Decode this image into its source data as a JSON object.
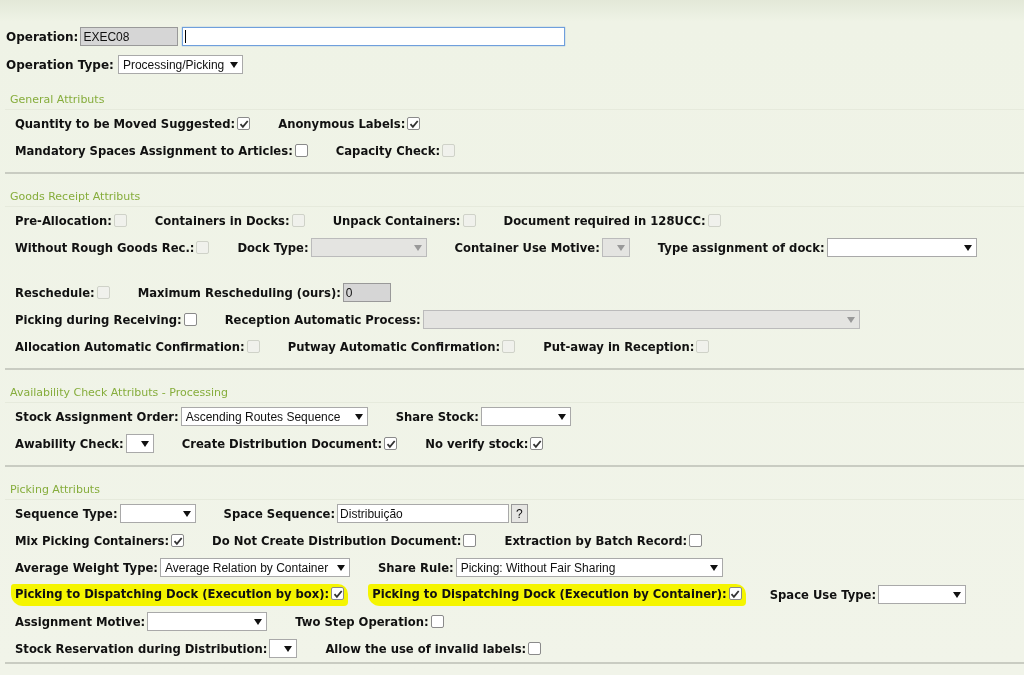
{
  "header": {
    "operation": {
      "label": "Operation:",
      "code": "EXEC08",
      "focused": true
    },
    "operation_type": {
      "label": "Operation Type:",
      "value": "Processing/Picking"
    }
  },
  "sections": [
    {
      "title": "General Attributs",
      "rows": [
        {
          "fields": [
            {
              "kind": "checkbox",
              "label": "Quantity to be Moved Suggested:",
              "checked": true,
              "disabled": false,
              "highlighted": false
            },
            {
              "kind": "checkbox",
              "label": "Anonymous Labels:",
              "checked": true,
              "disabled": false,
              "highlighted": false
            }
          ]
        },
        {
          "fields": [
            {
              "kind": "checkbox",
              "label": "Mandatory Spaces Assignment to Articles:",
              "checked": false,
              "disabled": false,
              "highlighted": false
            },
            {
              "kind": "checkbox",
              "label": "Capacity Check:",
              "checked": false,
              "disabled": true,
              "highlighted": false
            }
          ]
        }
      ]
    },
    {
      "title": "Goods Receipt Attributs",
      "rows": [
        {
          "fields": [
            {
              "kind": "checkbox",
              "label": "Pre-Allocation:",
              "checked": false,
              "disabled": true,
              "highlighted": false
            },
            {
              "kind": "checkbox",
              "label": "Containers in Docks:",
              "checked": false,
              "disabled": true,
              "highlighted": false
            },
            {
              "kind": "checkbox",
              "label": "Unpack Containers:",
              "checked": false,
              "disabled": true,
              "highlighted": false
            },
            {
              "kind": "checkbox",
              "label": "Document required in 128UCC:",
              "checked": false,
              "disabled": true,
              "highlighted": false
            }
          ]
        },
        {
          "fields": [
            {
              "kind": "checkbox",
              "label": "Without Rough Goods Rec.:",
              "checked": false,
              "disabled": true,
              "highlighted": false
            },
            {
              "kind": "select",
              "label": "Dock Type:",
              "disabled": true
            },
            {
              "kind": "select",
              "label": "Container Use Motive:",
              "disabled": true
            },
            {
              "kind": "select",
              "label": "Type assignment of dock:",
              "disabled": false
            }
          ]
        },
        {
          "fields": [
            {
              "kind": "checkbox",
              "label": "Reschedule:",
              "checked": false,
              "disabled": true,
              "highlighted": false
            },
            {
              "kind": "text",
              "label": "Maximum Rescheduling (ours):",
              "value": "0",
              "disabled": true
            }
          ]
        },
        {
          "fields": [
            {
              "kind": "checkbox",
              "label": "Picking during Receiving:",
              "checked": false,
              "disabled": false,
              "highlighted": false
            },
            {
              "kind": "select",
              "label": "Reception Automatic Process:",
              "disabled": true
            }
          ]
        },
        {
          "fields": [
            {
              "kind": "checkbox",
              "label": "Allocation Automatic Confirmation:",
              "checked": false,
              "disabled": true,
              "highlighted": false
            },
            {
              "kind": "checkbox",
              "label": "Putway Automatic Confirmation:",
              "checked": false,
              "disabled": true,
              "highlighted": false
            },
            {
              "kind": "checkbox",
              "label": "Put-away in Reception:",
              "checked": false,
              "disabled": true,
              "highlighted": false
            }
          ]
        }
      ]
    },
    {
      "title": "Availability Check Attributs - Processing",
      "rows": [
        {
          "fields": [
            {
              "kind": "select",
              "label": "Stock Assignment Order:",
              "value": "Ascending Routes Sequence",
              "disabled": false
            },
            {
              "kind": "select",
              "label": "Share Stock:",
              "disabled": false
            }
          ]
        },
        {
          "fields": [
            {
              "kind": "select",
              "label": "Awability Check:",
              "disabled": false
            },
            {
              "kind": "checkbox",
              "label": "Create Distribution Document:",
              "checked": true,
              "disabled": false,
              "highlighted": false
            },
            {
              "kind": "checkbox",
              "label": "No verify stock:",
              "checked": true,
              "disabled": false,
              "highlighted": false
            }
          ]
        }
      ]
    },
    {
      "title": "Picking Attributs",
      "rows": [
        {
          "fields": [
            {
              "kind": "select",
              "label": "Sequence Type:",
              "disabled": false
            },
            {
              "kind": "lookup",
              "label": "Space Sequence:",
              "value": "Distribuição",
              "button": "?"
            }
          ]
        },
        {
          "fields": [
            {
              "kind": "checkbox",
              "label": "Mix Picking Containers:",
              "checked": true,
              "disabled": false,
              "highlighted": false
            },
            {
              "kind": "checkbox",
              "label": "Do Not Create Distribution Document:",
              "checked": false,
              "disabled": false,
              "highlighted": false
            },
            {
              "kind": "checkbox",
              "label": "Extraction by Batch Record:",
              "checked": false,
              "disabled": false,
              "highlighted": false
            }
          ]
        },
        {
          "fields": [
            {
              "kind": "select",
              "label": "Average Weight Type:",
              "value": "Average Relation by Container",
              "disabled": false
            },
            {
              "kind": "select",
              "label": "Share Rule:",
              "value": "Picking: Without Fair Sharing",
              "disabled": false
            }
          ]
        },
        {
          "fields": [
            {
              "kind": "checkbox",
              "label": "Picking to Dispatching Dock (Execution by box):",
              "checked": true,
              "disabled": false,
              "highlighted": true
            },
            {
              "kind": "checkbox",
              "label": "Picking to Dispatching Dock (Execution by Container):",
              "checked": true,
              "disabled": false,
              "highlighted": true
            },
            {
              "kind": "select",
              "label": "Space Use Type:",
              "disabled": false
            }
          ]
        },
        {
          "fields": [
            {
              "kind": "select",
              "label": "Assignment Motive:",
              "disabled": false
            },
            {
              "kind": "checkbox",
              "label": "Two Step Operation:",
              "checked": false,
              "disabled": false,
              "highlighted": false
            }
          ]
        },
        {
          "fields": [
            {
              "kind": "select",
              "label": "Stock Reservation during Distribution:",
              "disabled": false
            },
            {
              "kind": "checkbox",
              "label": "Allow the use of invalid labels:",
              "checked": false,
              "disabled": false,
              "highlighted": false
            }
          ]
        }
      ]
    }
  ]
}
